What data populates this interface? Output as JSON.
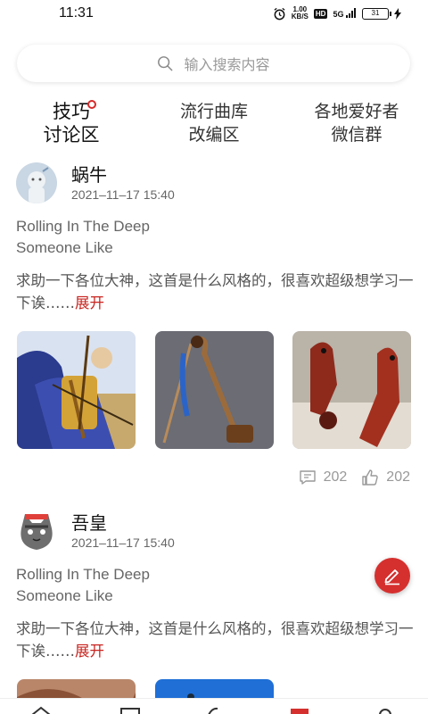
{
  "status_bar": {
    "time": "11:31",
    "speed_value": "1.00",
    "speed_unit": "KB/S",
    "hd_badge": "HD",
    "signal": "5G",
    "battery": "31"
  },
  "search": {
    "placeholder": "输入搜索内容",
    "icon": "search-icon"
  },
  "tabs": [
    {
      "line1": "技巧",
      "line2": "讨论区",
      "active": true
    },
    {
      "line1": "流行曲库",
      "line2": "改编区",
      "active": false
    },
    {
      "line1": "各地爱好者",
      "line2": "微信群",
      "active": false
    }
  ],
  "posts": [
    {
      "author": "蜗牛",
      "time": "2021–11–17  15:40",
      "song_1": "Rolling In The Deep",
      "song_2": "Someone Like",
      "body": "求助一下各位大神，这首是什么风格的，很喜欢超级想学习一下诶……",
      "expand": "展开",
      "comments": "202",
      "likes": "202"
    },
    {
      "author": "吾皇",
      "time": "2021–11–17  15:40",
      "song_1": "Rolling In The Deep",
      "song_2": "Someone Like",
      "body": "求助一下各位大神，这首是什么风格的，很喜欢超级想学习一下诶……",
      "expand": "展开"
    }
  ],
  "colors": {
    "accent": "#d5302e",
    "expand": "#c8241f",
    "muted": "#999999"
  }
}
